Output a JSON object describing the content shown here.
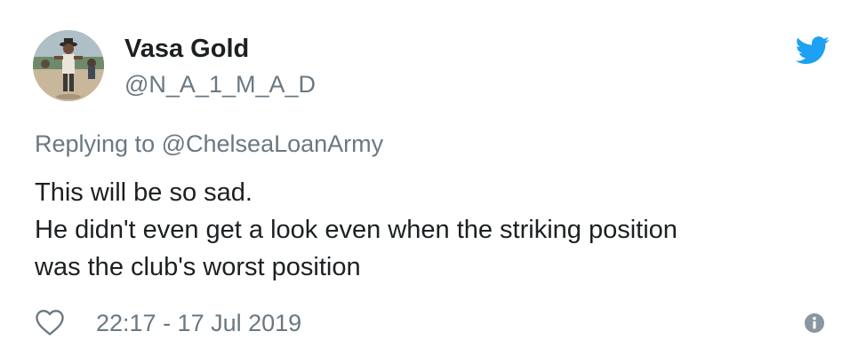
{
  "tweet": {
    "author": {
      "display_name": "Vasa Gold",
      "handle": "@N_A_1_M_A_D"
    },
    "reply": {
      "prefix": "Replying to",
      "target": "@ChelseaLoanArmy"
    },
    "text_lines": [
      "This will be so sad.",
      "He didn't even get a look even when the striking position",
      "was the club's worst position"
    ],
    "timestamp": "22:17 - 17 Jul 2019"
  },
  "icons": {
    "brand": "twitter-bird-icon",
    "like": "heart-outline-icon",
    "info": "info-circle-icon"
  },
  "colors": {
    "twitter_blue": "#1da1f2",
    "text_primary": "#1c2022",
    "text_secondary": "#697882"
  }
}
